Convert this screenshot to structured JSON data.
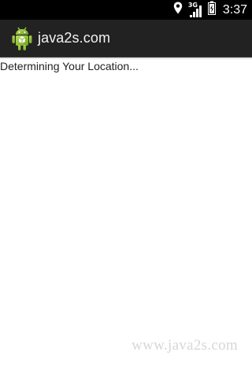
{
  "status_bar": {
    "time": "3:37",
    "network_label": "3G",
    "icons": [
      "location-pin-icon",
      "signal-icon",
      "battery-icon"
    ]
  },
  "action_bar": {
    "title": "java2s.com",
    "icon": "android-icon",
    "background_color": "#222222"
  },
  "content": {
    "message": "Determining Your Location..."
  },
  "watermark": {
    "text": "www.java2s.com"
  }
}
